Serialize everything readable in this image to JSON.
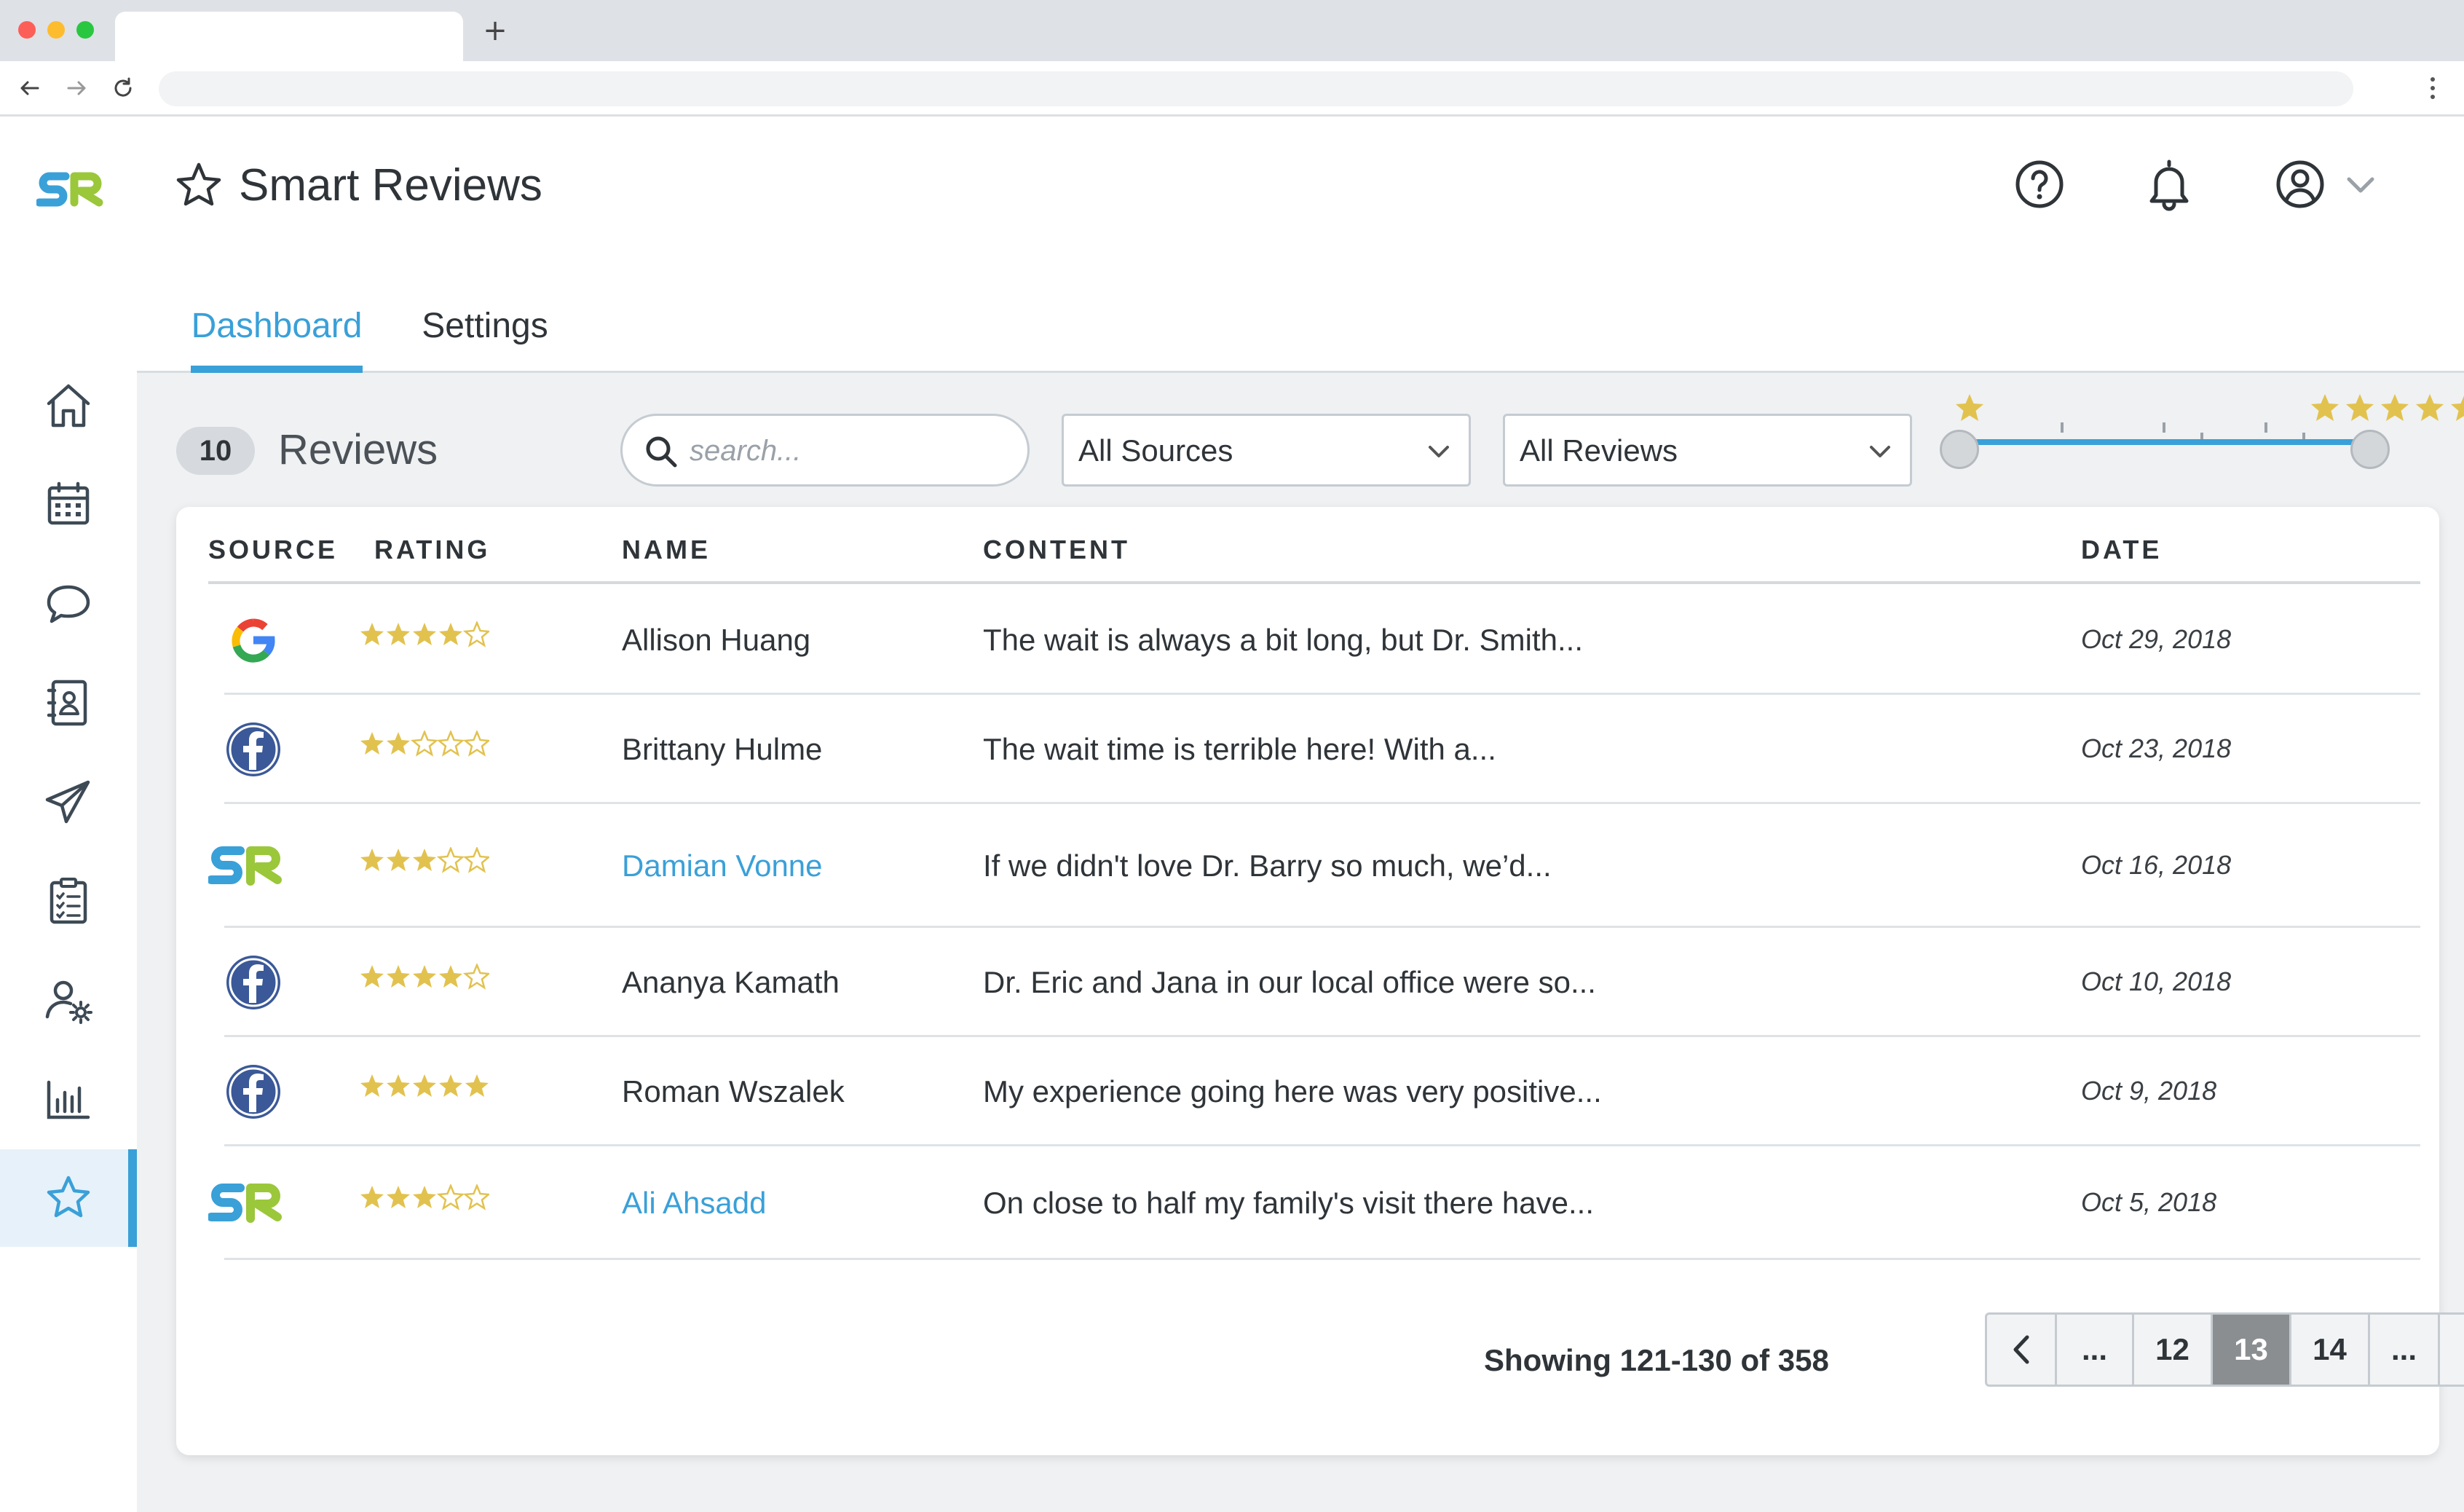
{
  "app": {
    "title": "Smart Reviews",
    "logo_text": "SR"
  },
  "colors": {
    "accent": "#3aa0d8",
    "logo_lime": "#9bc73b",
    "star_gold": "#e2c24f",
    "facebook": "#3b5998"
  },
  "sidebar": {
    "items": [
      {
        "icon": "home-icon"
      },
      {
        "icon": "calendar-icon"
      },
      {
        "icon": "chat-icon"
      },
      {
        "icon": "contacts-icon"
      },
      {
        "icon": "send-icon"
      },
      {
        "icon": "clipboard-icon"
      },
      {
        "icon": "user-settings-icon"
      },
      {
        "icon": "bar-chart-icon"
      },
      {
        "icon": "star-icon",
        "active": true
      }
    ]
  },
  "tabs": {
    "dashboard": "Dashboard",
    "settings": "Settings",
    "active": "Dashboard"
  },
  "toolbar": {
    "count": "10",
    "count_label": "Reviews",
    "search_placeholder": "search...",
    "source_filter": "All Sources",
    "review_filter": "All Reviews",
    "rating_range": {
      "min": 1,
      "max": 5
    }
  },
  "table": {
    "columns": {
      "source": "SOURCE",
      "rating": "RATING",
      "name": "NAME",
      "content": "CONTENT",
      "date": "DATE"
    },
    "rows": [
      {
        "source": "google",
        "rating": 4,
        "name": "Allison Huang",
        "name_link": false,
        "content": "The wait is always a bit long, but Dr. Smith...",
        "date": "Oct 29, 2018"
      },
      {
        "source": "facebook",
        "rating": 2,
        "name": "Brittany Hulme",
        "name_link": false,
        "content": "The wait time is terrible here! With a...",
        "date": "Oct 23, 2018"
      },
      {
        "source": "smart-reviews",
        "rating": 3,
        "name": "Damian Vonne",
        "name_link": true,
        "content": "If we didn't love Dr. Barry so much, we’d...",
        "date": "Oct 16, 2018"
      },
      {
        "source": "facebook",
        "rating": 4,
        "name": "Ananya Kamath",
        "name_link": false,
        "content": "Dr. Eric and Jana in our local office were so...",
        "date": "Oct 10, 2018"
      },
      {
        "source": "facebook",
        "rating": 5,
        "name": "Roman Wszalek",
        "name_link": false,
        "content": "My experience going here was very positive...",
        "date": "Oct 9, 2018"
      },
      {
        "source": "smart-reviews",
        "rating": 3,
        "name": "Ali Ahsadd",
        "name_link": true,
        "content": "On close to half my family's visit there have...",
        "date": "Oct 5, 2018"
      }
    ]
  },
  "pagination": {
    "showing": "Showing 121-130 of  358",
    "pages": [
      "...",
      "12",
      "13",
      "14",
      "..."
    ],
    "current": "13"
  }
}
